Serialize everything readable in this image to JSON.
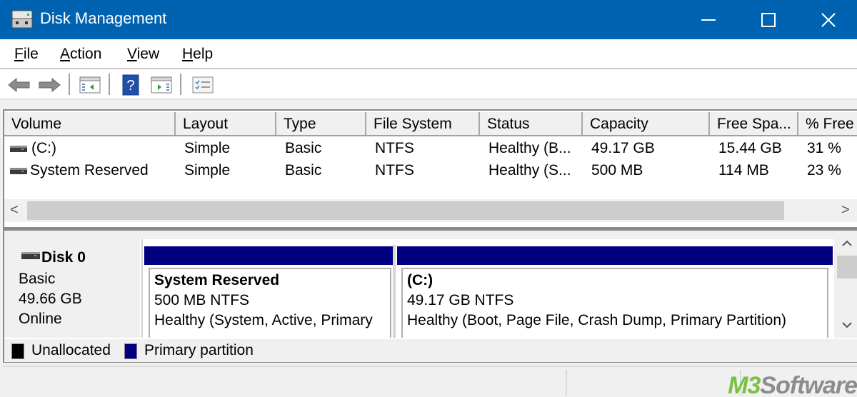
{
  "window": {
    "title": "Disk Management",
    "controls": {
      "minimize": "minimize",
      "maximize": "maximize",
      "close": "close"
    }
  },
  "menu": [
    {
      "accel": "F",
      "rest": "ile"
    },
    {
      "accel": "A",
      "rest": "ction"
    },
    {
      "accel": "V",
      "rest": "iew"
    },
    {
      "accel": "H",
      "rest": "elp"
    }
  ],
  "toolbar": {
    "icons": [
      "back-arrow-icon",
      "forward-arrow-icon",
      "show-hide-console-tree-icon",
      "help-icon",
      "show-hide-action-pane-icon",
      "properties-list-icon"
    ]
  },
  "volume_list": {
    "columns": [
      "Volume",
      "Layout",
      "Type",
      "File System",
      "Status",
      "Capacity",
      "Free Spa...",
      "% Free"
    ],
    "rows": [
      {
        "volume": " (C:)",
        "layout": "Simple",
        "type": "Basic",
        "fs": "NTFS",
        "status": "Healthy (B...",
        "capacity": "49.17 GB",
        "free": "15.44 GB",
        "pct_free": "31 %"
      },
      {
        "volume": "System Reserved",
        "layout": "Simple",
        "type": "Basic",
        "fs": "NTFS",
        "status": "Healthy (S...",
        "capacity": "500 MB",
        "free": "114 MB",
        "pct_free": "23 %"
      }
    ],
    "hscroll": {
      "left": "<",
      "right": ">"
    }
  },
  "disk": {
    "name": "Disk 0",
    "type": "Basic",
    "size": "49.66 GB",
    "state": "Online",
    "partitions": [
      {
        "name": "System Reserved",
        "size_fs": "500 MB NTFS",
        "status": "Healthy (System, Active, Primary"
      },
      {
        "name": " (C:)",
        "size_fs": "49.17 GB NTFS",
        "status": "Healthy (Boot, Page File, Crash Dump, Primary Partition)"
      }
    ],
    "vscroll": {
      "up": "^",
      "down": "v"
    }
  },
  "legend": [
    {
      "label": "Unallocated",
      "color": "#000000"
    },
    {
      "label": "Primary partition",
      "color": "#000080"
    }
  ],
  "watermark": {
    "brand": "M3",
    "rest": "Software"
  },
  "colors": {
    "titlebar": "#0063b1",
    "primary_partition": "#000080",
    "unallocated": "#000000"
  }
}
